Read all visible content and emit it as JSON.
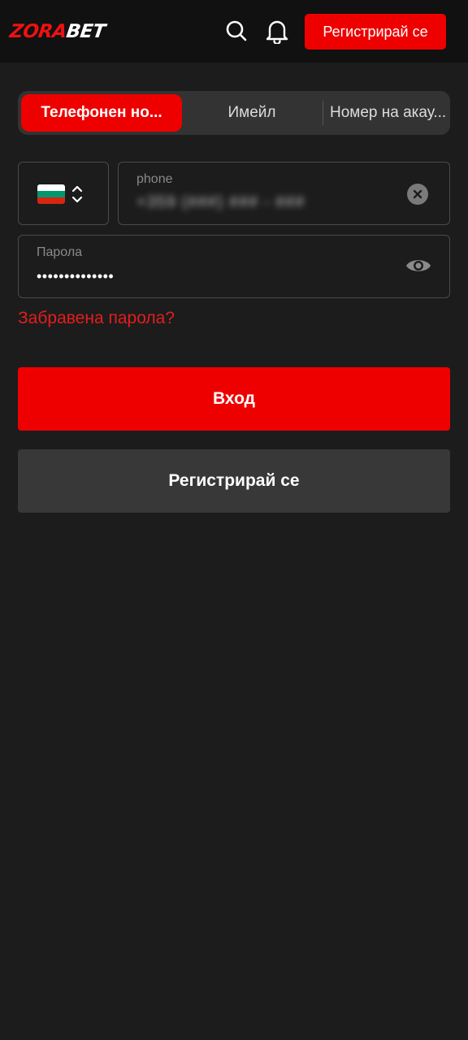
{
  "header": {
    "logo_part1": "ZORA",
    "logo_part2": "BET",
    "register_label": "Регистрирай се",
    "icons": [
      "search-icon",
      "bell-icon"
    ]
  },
  "tabs": [
    {
      "label": "Телефонен но...",
      "active": true
    },
    {
      "label": "Имейл",
      "active": false
    },
    {
      "label": "Номер на акау...",
      "active": false
    }
  ],
  "form": {
    "country_flag": "bulgaria-flag",
    "phone_label": "phone",
    "phone_value": "+359 (###) ### - ###",
    "password_label": "Парола",
    "password_value": "••••••••••••••",
    "forgot_password": "Забравена парола?"
  },
  "buttons": {
    "login": "Вход",
    "register": "Регистрирай се"
  },
  "colors": {
    "accent": "#ee0000",
    "background": "#1c1c1c",
    "header_bg": "#111111",
    "secondary_button": "#383838"
  }
}
